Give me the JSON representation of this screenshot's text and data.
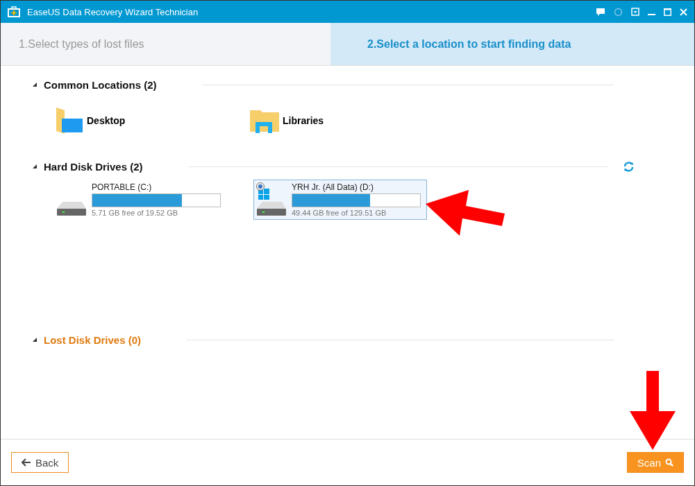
{
  "window": {
    "title": "EaseUS Data Recovery Wizard Technician"
  },
  "steps": [
    {
      "label": "1.Select types of lost files",
      "selected": false
    },
    {
      "label": "2.Select a location to start finding data",
      "selected": true
    }
  ],
  "common_locations": {
    "title": "Common Locations (2)",
    "items": [
      {
        "label": "Desktop",
        "kind": "desktop"
      },
      {
        "label": "Libraries",
        "kind": "libraries"
      }
    ]
  },
  "hard_disk_drives": {
    "title": "Hard Disk Drives (2)",
    "drives": [
      {
        "name": "PORTABLE (C:)",
        "free": "5.71 GB free of 19.52 GB",
        "level": 0.7,
        "selected": false,
        "system": false
      },
      {
        "name": "YRH Jr. (All Data) (D:)",
        "free": "49.44 GB free of 129.51 GB",
        "level": 0.61,
        "selected": true,
        "system": true
      }
    ]
  },
  "lost_disk_drives": {
    "title": "Lost Disk Drives (0)"
  },
  "buttons": {
    "back": "Back",
    "scan": "Scan"
  }
}
